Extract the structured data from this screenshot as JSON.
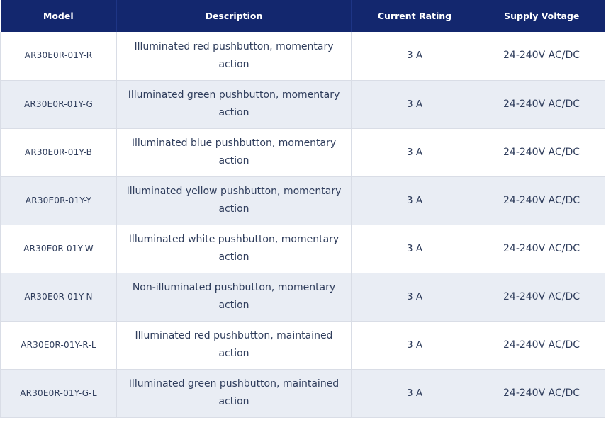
{
  "table": {
    "headers": [
      "Model",
      "Description",
      "Current Rating",
      "Supply Voltage"
    ],
    "rows": [
      {
        "model": "AR30E0R-01Y-R",
        "description": "Illuminated red pushbutton, momentary action",
        "rating": "3 A",
        "voltage": "24-240V AC/DC"
      },
      {
        "model": "AR30E0R-01Y-G",
        "description": "Illuminated green pushbutton, momentary action",
        "rating": "3 A",
        "voltage": "24-240V AC/DC"
      },
      {
        "model": "AR30E0R-01Y-B",
        "description": "Illuminated blue pushbutton, momentary action",
        "rating": "3 A",
        "voltage": "24-240V AC/DC"
      },
      {
        "model": "AR30E0R-01Y-Y",
        "description": "Illuminated yellow pushbutton, momentary action",
        "rating": "3 A",
        "voltage": "24-240V AC/DC"
      },
      {
        "model": "AR30E0R-01Y-W",
        "description": "Illuminated white pushbutton, momentary action",
        "rating": "3 A",
        "voltage": "24-240V AC/DC"
      },
      {
        "model": "AR30E0R-01Y-N",
        "description": "Non-illuminated pushbutton, momentary action",
        "rating": "3 A",
        "voltage": "24-240V AC/DC"
      },
      {
        "model": "AR30E0R-01Y-R-L",
        "description": "Illuminated red pushbutton, maintained action",
        "rating": "3 A",
        "voltage": "24-240V AC/DC"
      },
      {
        "model": "AR30E0R-01Y-G-L",
        "description": "Illuminated green pushbutton, maintained action",
        "rating": "3 A",
        "voltage": "24-240V AC/DC"
      }
    ]
  },
  "colors": {
    "header_background": "#13276e",
    "header_text": "#ffffff",
    "stripe_row": "#e9edf4",
    "body_text": "#2f3d5c",
    "border": "#d9dde6"
  }
}
